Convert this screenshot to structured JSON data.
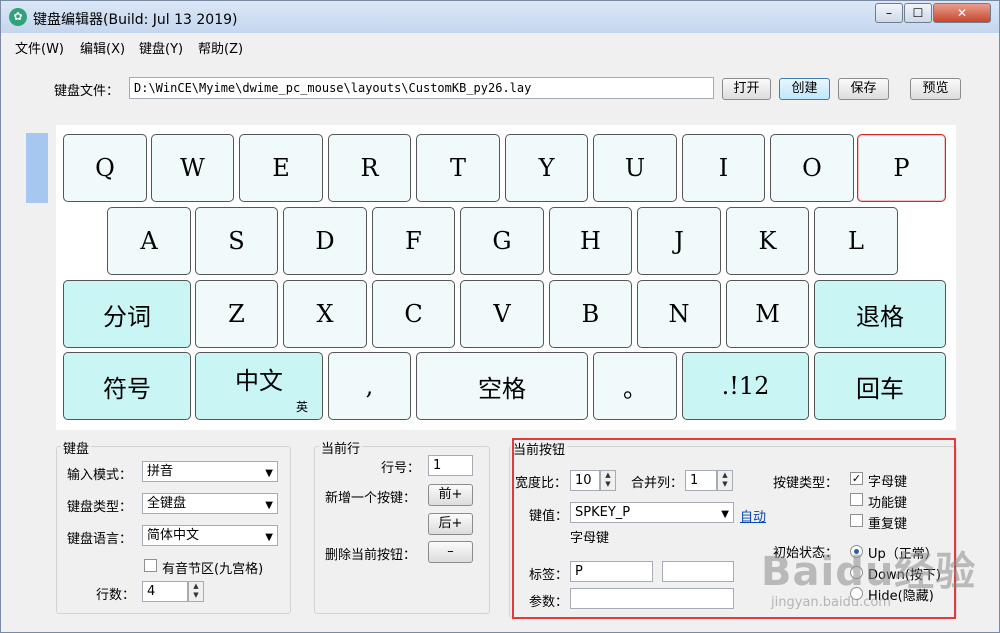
{
  "window": {
    "title": "键盘编辑器(Build: Jul 13 2019)",
    "app_icon": "✿"
  },
  "titlebar_buttons": {
    "minimize": "–",
    "maximize": "☐",
    "close": "✕"
  },
  "menu": [
    "文件(W)",
    "编辑(X)",
    "键盘(Y)",
    "帮助(Z)"
  ],
  "file_row": {
    "label": "键盘文件：",
    "path": "D:\\WinCE\\Myime\\dwime_pc_mouse\\layouts\\CustomKB_py26.lay",
    "open": "打开",
    "create": "创建",
    "save": "保存",
    "preview": "预览"
  },
  "keyboard": {
    "row1": [
      "Q",
      "W",
      "E",
      "R",
      "T",
      "Y",
      "U",
      "I",
      "O",
      "P"
    ],
    "row2": [
      "A",
      "S",
      "D",
      "F",
      "G",
      "H",
      "J",
      "K",
      "L"
    ],
    "row3": [
      "分词",
      "Z",
      "X",
      "C",
      "V",
      "B",
      "N",
      "M",
      "退格"
    ],
    "row4": [
      "符号",
      "中文",
      ",",
      "空格",
      "。",
      ".!12",
      "回车"
    ],
    "row4_sub": "英"
  },
  "kb_group": {
    "title": "键盘",
    "input_mode_label": "输入模式：",
    "input_mode": "拼音",
    "kb_type_label": "键盘类型：",
    "kb_type": "全键盘",
    "kb_lang_label": "键盘语言：",
    "kb_lang": "简体中文",
    "has_tone": "有音节区(九宫格)",
    "rows_label": "行数：",
    "rows": "4"
  },
  "row_group": {
    "title": "当前行",
    "row_no_label": "行号：",
    "row_no": "1",
    "add_label": "新增一个按键：",
    "add_before": "前+",
    "add_after": "后+",
    "del_label": "删除当前按钮：",
    "del_btn": "–"
  },
  "btn_group": {
    "title": "当前按钮",
    "width_label": "宽度比：",
    "width": "10",
    "merge_label": "合并列：",
    "merge": "1",
    "key_type_label": "按键类型：",
    "chk_letter": "字母键",
    "chk_func": "功能键",
    "chk_repeat": "重复键",
    "value_label": "键值：",
    "value": "SPKEY_P",
    "auto": "自动",
    "value_desc": "字母键",
    "init_state_label": "初始状态：",
    "radio_up": "Up（正常）",
    "radio_down": "Down(按下)",
    "radio_hide": "Hide(隐藏)",
    "tag_label": "标签：",
    "tag": "P",
    "param_label": "参数："
  },
  "watermark": {
    "main": "Baidu经验",
    "sub": "jingyan.baidu.com"
  }
}
